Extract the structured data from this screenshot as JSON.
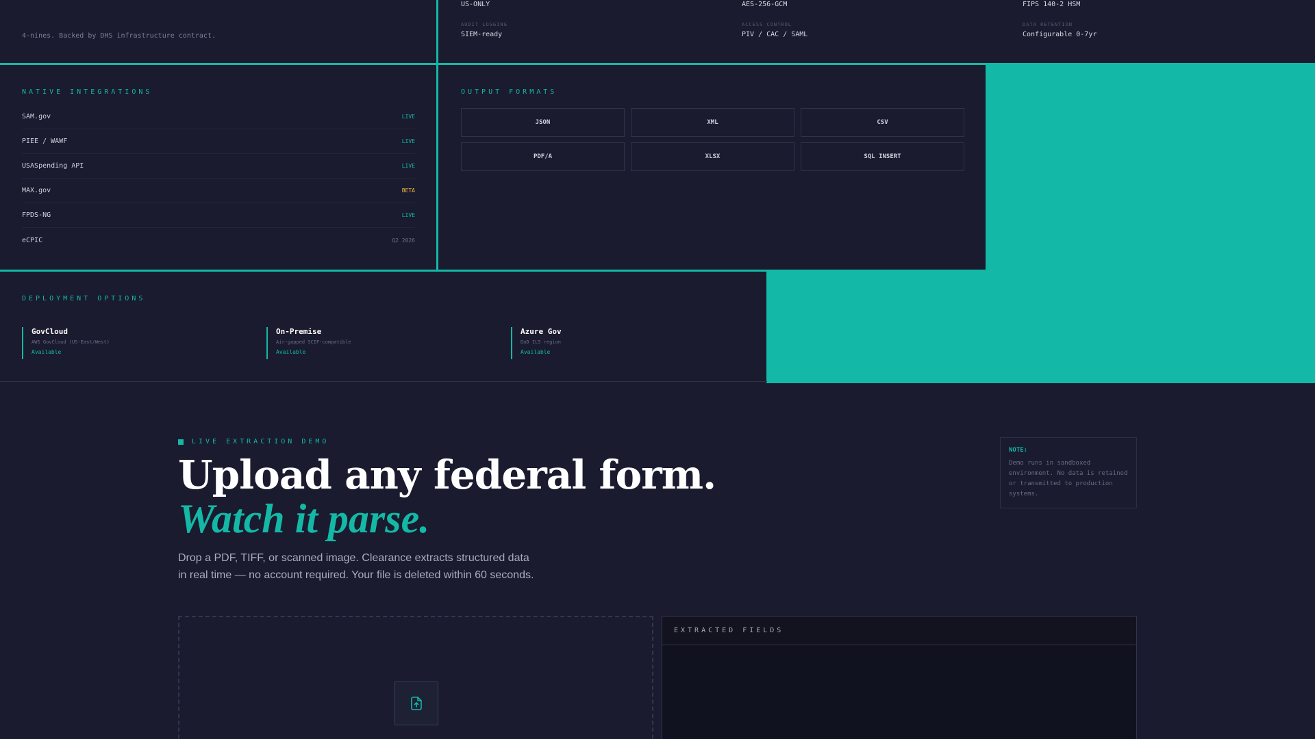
{
  "uptime": {
    "text": "4-nines. Backed by DHS infrastructure contract."
  },
  "security": [
    {
      "label": "",
      "value": "US-ONLY"
    },
    {
      "label": "",
      "value": "AES-256-GCM"
    },
    {
      "label": "",
      "value": "FIPS 140-2 HSM"
    },
    {
      "label": "AUDIT LOGGING",
      "value": "SIEM-ready"
    },
    {
      "label": "ACCESS CONTROL",
      "value": "PIV / CAC / SAML"
    },
    {
      "label": "DATA RETENTION",
      "value": "Configurable 0-7yr"
    }
  ],
  "integrations": {
    "title": "NATIVE INTEGRATIONS",
    "items": [
      {
        "name": "SAM.gov",
        "status": "LIVE"
      },
      {
        "name": "PIEE / WAWF",
        "status": "LIVE"
      },
      {
        "name": "USASpending API",
        "status": "LIVE"
      },
      {
        "name": "MAX.gov",
        "status": "BETA"
      },
      {
        "name": "FPDS-NG",
        "status": "LIVE"
      },
      {
        "name": "eCPIC",
        "status": "Q2 2026"
      }
    ]
  },
  "formats": {
    "title": "OUTPUT FORMATS",
    "items": [
      "JSON",
      "XML",
      "CSV",
      "PDF/A",
      "XLSX",
      "SQL INSERT"
    ]
  },
  "deployment": {
    "title": "DEPLOYMENT OPTIONS",
    "items": [
      {
        "name": "GovCloud",
        "desc": "AWS GovCloud (US-East/West)",
        "status": "Available"
      },
      {
        "name": "On-Premise",
        "desc": "Air-gapped SCIF-compatible",
        "status": "Available"
      },
      {
        "name": "Azure Gov",
        "desc": "DoD IL5 region",
        "status": "Available"
      }
    ]
  },
  "demo": {
    "kicker": "LIVE EXTRACTION DEMO",
    "headline": "Upload any federal form.",
    "headline_accent": "Watch it parse.",
    "subcopy": "Drop a PDF, TIFF, or scanned image. Clearance extracts structured data in real time — no account required. Your file is deleted within 60 seconds.",
    "note_title": "NOTE:",
    "note_body": "Demo runs in sandboxed environment. No data is retained or transmitted to production systems.",
    "fields_title": "EXTRACTED FIELDS"
  },
  "colors": {
    "accent": "#14b8a6",
    "beta": "#f5b83d",
    "background": "#1a1b2e"
  },
  "icons": {
    "upload": "file-upload-icon"
  }
}
